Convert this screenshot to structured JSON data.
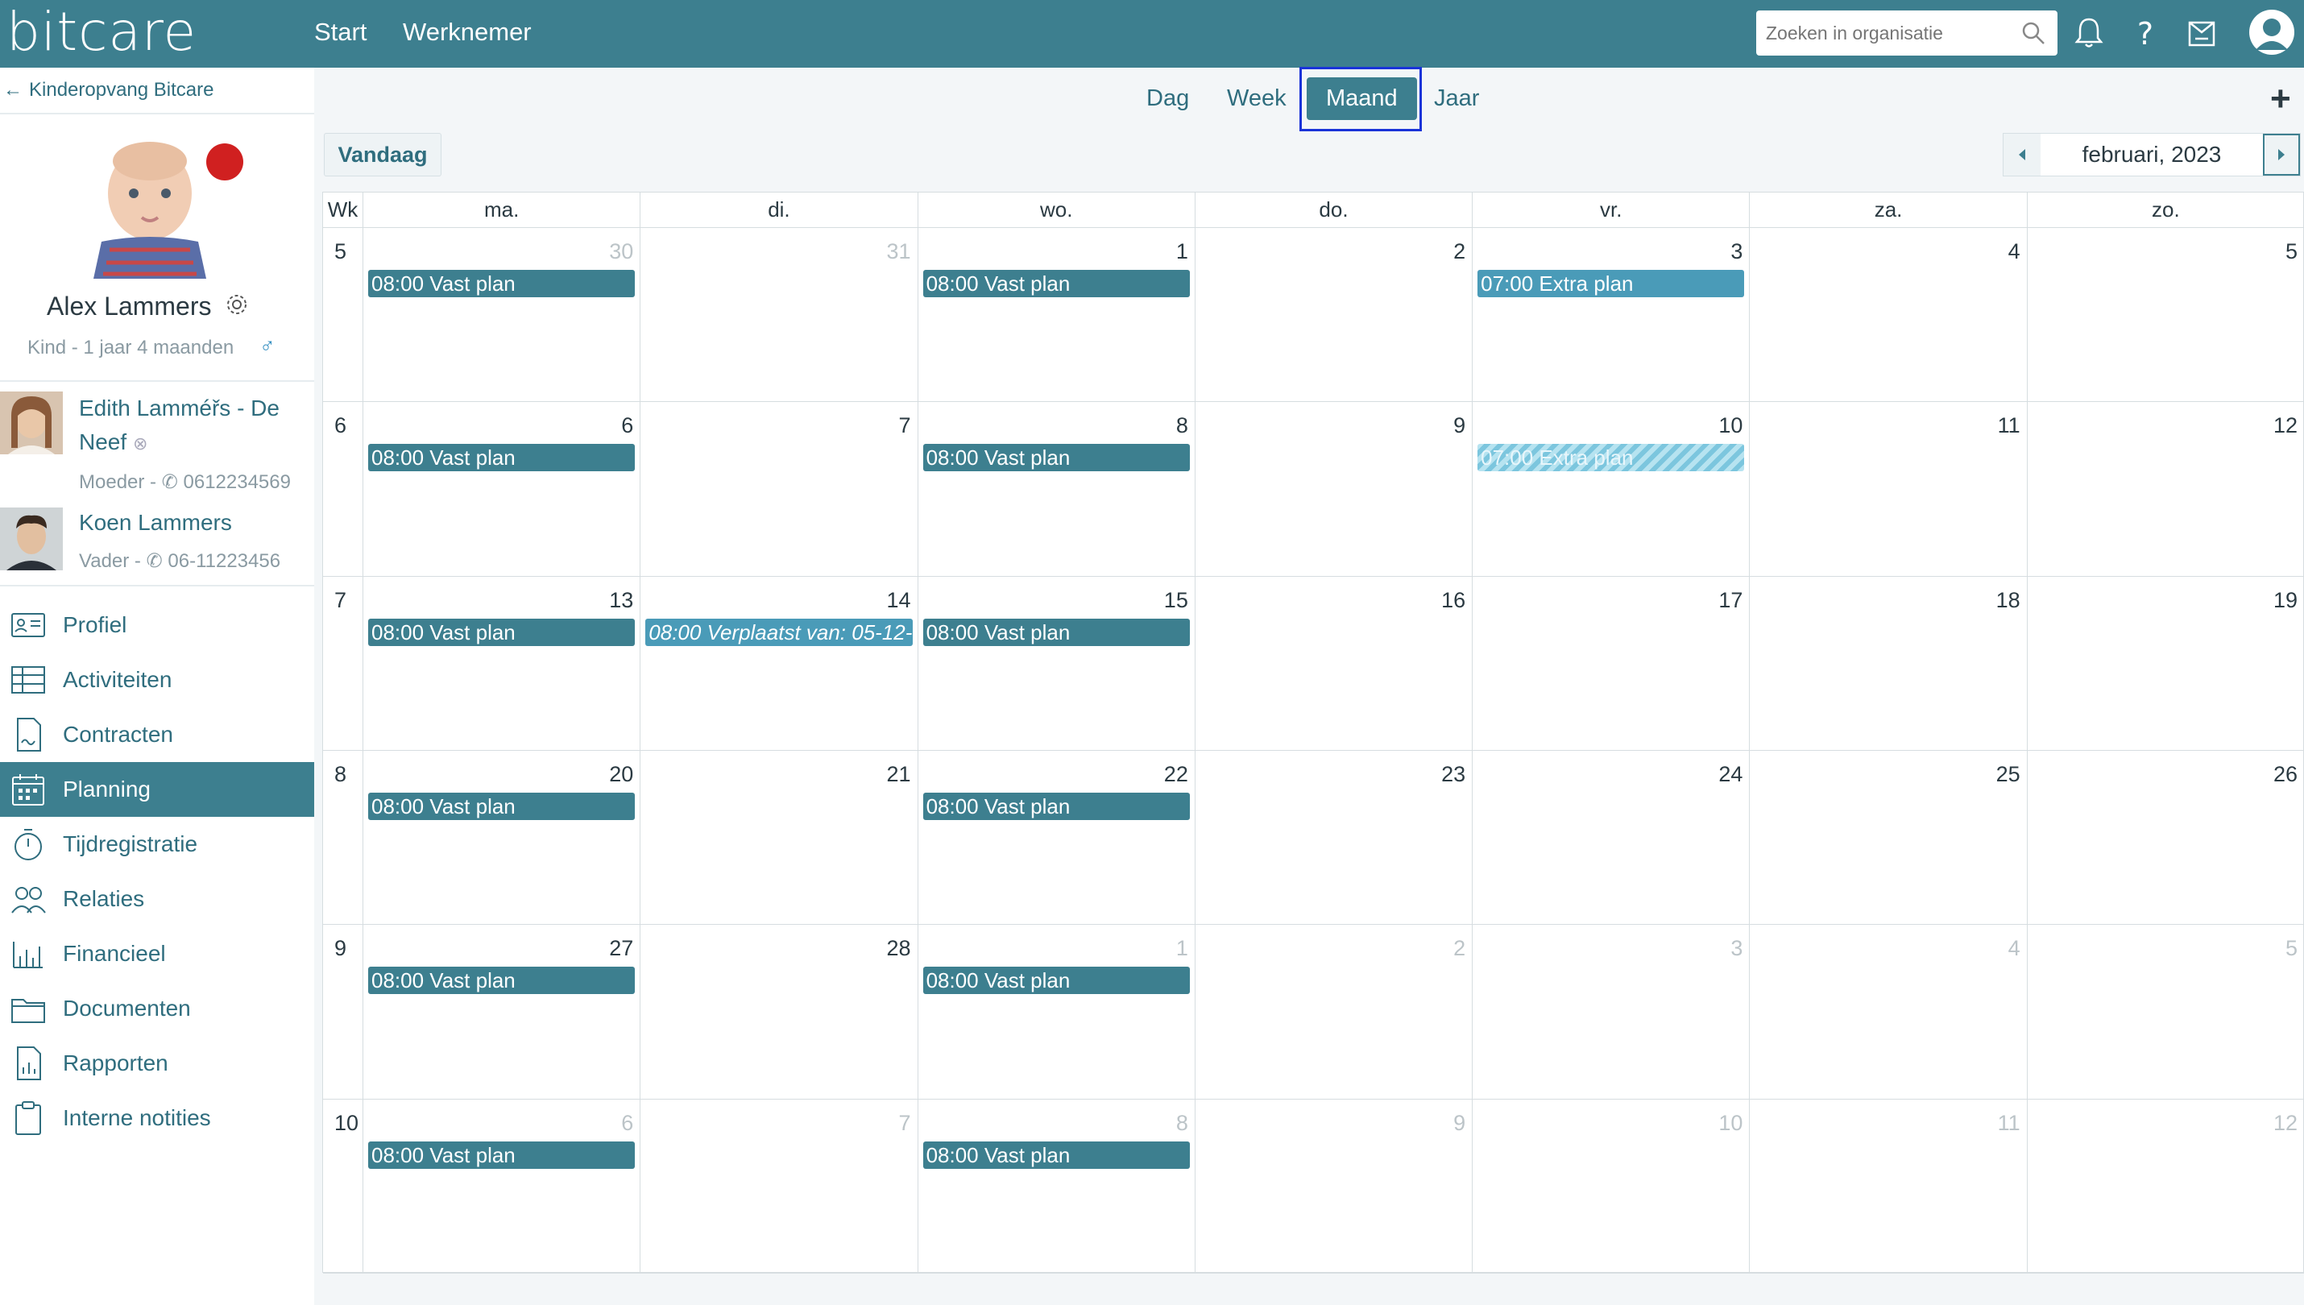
{
  "app": {
    "logo": "bitcare",
    "nav": [
      "Start",
      "Werknemer"
    ],
    "search_placeholder": "Zoeken in organisatie"
  },
  "sidebar": {
    "back_label": "Kinderopvang Bitcare",
    "person": {
      "name": "Alex Lammers",
      "subtitle": "Kind - 1 jaar 4 maanden",
      "gender_symbol": "♂"
    },
    "relations": [
      {
        "name_line1": "Edith Lamméřs - De",
        "name_line2": "Neef",
        "role": "Moeder -",
        "phone": "0612234569"
      },
      {
        "name_line1": "Koen Lammers",
        "role": "Vader -",
        "phone": "06-11223456"
      }
    ],
    "menu": [
      {
        "label": "Profiel",
        "icon": "profile-card-icon"
      },
      {
        "label": "Activiteiten",
        "icon": "table-icon"
      },
      {
        "label": "Contracten",
        "icon": "contract-icon"
      },
      {
        "label": "Planning",
        "icon": "calendar-icon",
        "active": true
      },
      {
        "label": "Tijdregistratie",
        "icon": "stopwatch-icon"
      },
      {
        "label": "Relaties",
        "icon": "people-icon"
      },
      {
        "label": "Financieel",
        "icon": "bar-chart-icon"
      },
      {
        "label": "Documenten",
        "icon": "folder-icon"
      },
      {
        "label": "Rapporten",
        "icon": "report-icon"
      },
      {
        "label": "Interne notities",
        "icon": "clipboard-icon"
      }
    ]
  },
  "views": {
    "tabs": [
      "Dag",
      "Week",
      "Maand",
      "Jaar"
    ],
    "active": "Maand",
    "today_label": "Vandaag",
    "month_label": "februari, 2023"
  },
  "calendar": {
    "week_header": "Wk",
    "day_headers": [
      "ma.",
      "di.",
      "wo.",
      "do.",
      "vr.",
      "za.",
      "zo."
    ],
    "weeks": [
      {
        "wk": "5",
        "days": [
          {
            "d": "30",
            "other": true,
            "event": "08:00 Vast plan"
          },
          {
            "d": "31",
            "other": true
          },
          {
            "d": "1",
            "event": "08:00 Vast plan"
          },
          {
            "d": "2"
          },
          {
            "d": "3",
            "event": "07:00 Extra plan",
            "kind": "extra"
          },
          {
            "d": "4"
          },
          {
            "d": "5"
          }
        ]
      },
      {
        "wk": "6",
        "days": [
          {
            "d": "6",
            "event": "08:00 Vast plan"
          },
          {
            "d": "7"
          },
          {
            "d": "8",
            "event": "08:00 Vast plan"
          },
          {
            "d": "9"
          },
          {
            "d": "10",
            "event": "07:00 Extra plan",
            "kind": "hatched"
          },
          {
            "d": "11"
          },
          {
            "d": "12"
          }
        ]
      },
      {
        "wk": "7",
        "days": [
          {
            "d": "13",
            "event": "08:00 Vast plan"
          },
          {
            "d": "14",
            "event": "08:00 Verplaatst van: 05-12-",
            "kind": "moved"
          },
          {
            "d": "15",
            "event": "08:00 Vast plan"
          },
          {
            "d": "16"
          },
          {
            "d": "17"
          },
          {
            "d": "18"
          },
          {
            "d": "19"
          }
        ]
      },
      {
        "wk": "8",
        "days": [
          {
            "d": "20",
            "event": "08:00 Vast plan"
          },
          {
            "d": "21"
          },
          {
            "d": "22",
            "event": "08:00 Vast plan"
          },
          {
            "d": "23"
          },
          {
            "d": "24"
          },
          {
            "d": "25"
          },
          {
            "d": "26"
          }
        ]
      },
      {
        "wk": "9",
        "days": [
          {
            "d": "27",
            "event": "08:00 Vast plan"
          },
          {
            "d": "28"
          },
          {
            "d": "1",
            "other": true,
            "event": "08:00 Vast plan"
          },
          {
            "d": "2",
            "other": true
          },
          {
            "d": "3",
            "other": true
          },
          {
            "d": "4",
            "other": true
          },
          {
            "d": "5",
            "other": true
          }
        ]
      },
      {
        "wk": "10",
        "days": [
          {
            "d": "6",
            "other": true,
            "event": "08:00 Vast plan"
          },
          {
            "d": "7",
            "other": true
          },
          {
            "d": "8",
            "other": true,
            "event": "08:00 Vast plan"
          },
          {
            "d": "9",
            "other": true
          },
          {
            "d": "10",
            "other": true
          },
          {
            "d": "11",
            "other": true
          },
          {
            "d": "12",
            "other": true
          }
        ]
      }
    ]
  },
  "colors": {
    "primary": "#3d7f8f",
    "extra": "#4a9bb8",
    "alert": "#d02020",
    "highlight_outline": "#1a33d8"
  }
}
